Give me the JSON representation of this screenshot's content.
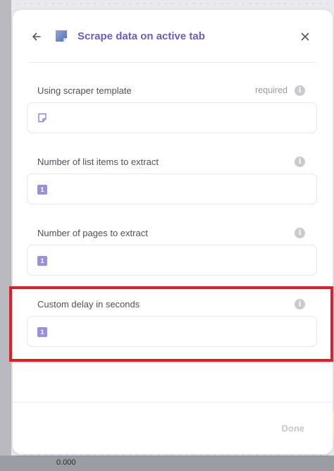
{
  "colors": {
    "accent": "#6c5cc8",
    "highlight": "#e11d27",
    "badge": "#9d8fdc"
  },
  "header": {
    "title": "Scrape data on active tab",
    "back_icon": "arrow-left-icon",
    "app_icon": "scraper-app-icon",
    "close_icon": "close-icon"
  },
  "fields": [
    {
      "label": "Using scraper template",
      "required": "required",
      "info_icon": "info-icon",
      "value_icon": "sticky-note-icon"
    },
    {
      "label": "Number of list items to extract",
      "info_icon": "info-icon",
      "value": "1"
    },
    {
      "label": "Number of pages to extract",
      "info_icon": "info-icon",
      "value": "1"
    },
    {
      "label": "Custom delay in seconds",
      "info_icon": "info-icon",
      "value": "1"
    }
  ],
  "footer": {
    "done_label": "Done"
  },
  "background": {
    "bottom_value": "0.000"
  }
}
